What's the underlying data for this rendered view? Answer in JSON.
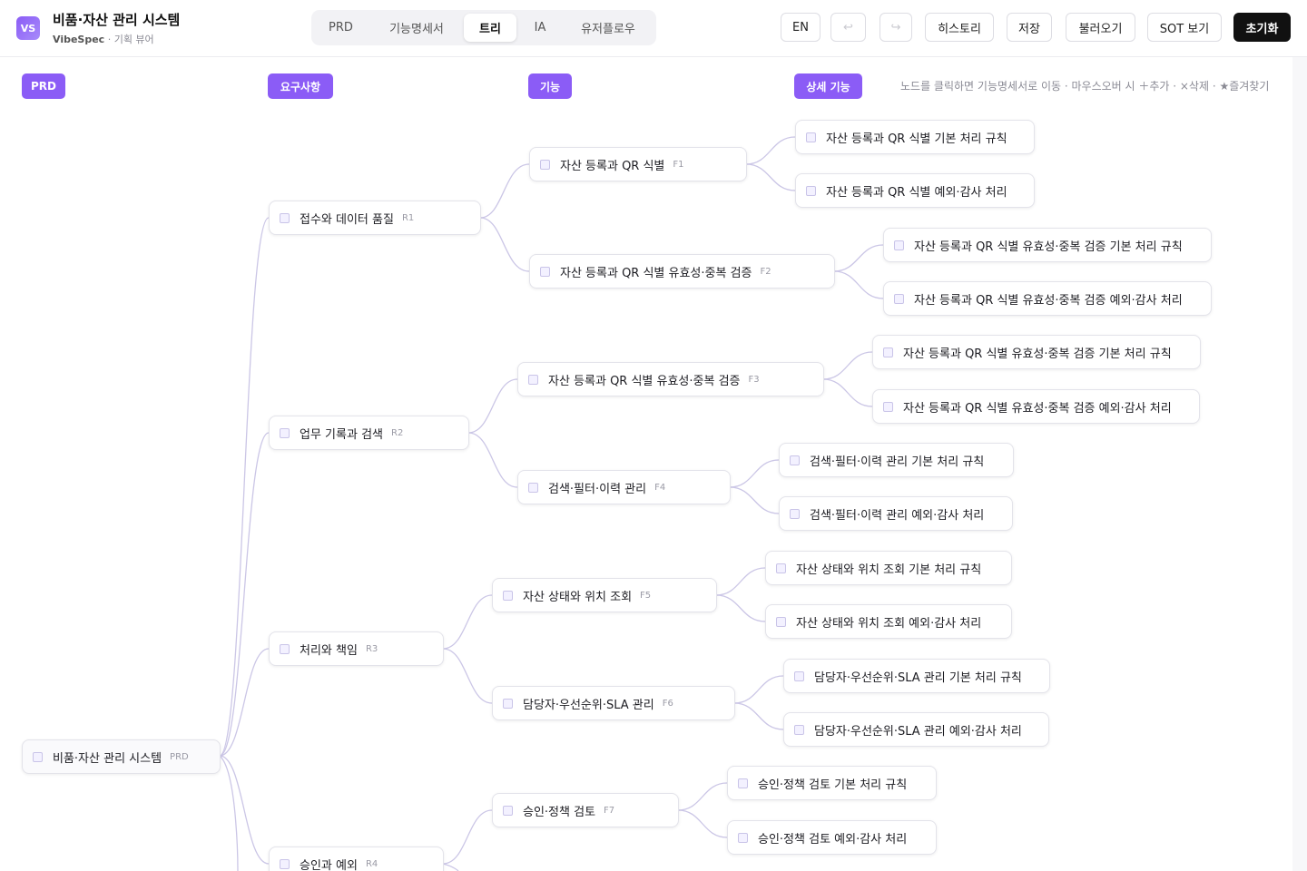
{
  "header": {
    "logo": "VS",
    "title": "비품·자산 관리 시스템",
    "brand": "VibeSpec",
    "subtitle": " · 기획 뷰어",
    "tabs": [
      {
        "label": "PRD",
        "active": false
      },
      {
        "label": "기능명세서",
        "active": false
      },
      {
        "label": "트리",
        "active": true
      },
      {
        "label": "IA",
        "active": false
      },
      {
        "label": "유저플로우",
        "active": false
      }
    ],
    "lang_label": "EN",
    "undo_icon": "undo-icon",
    "redo_icon": "redo-icon",
    "undo_glyph": "↩",
    "redo_glyph": "↪",
    "history_label": "히스토리",
    "save_label": "저장",
    "load_label": "불러오기",
    "sot_label": "SOT 보기",
    "reset_label": "초기화"
  },
  "columns": {
    "prd": "PRD",
    "requirements": "요구사항",
    "features": "기능",
    "details": "상세 기능"
  },
  "hint": "노드를 클릭하면 기능명세서로 이동 · 마우스오버 시 ＋추가 · ×삭제 · ★즐겨찾기",
  "tree": {
    "root": {
      "label": "비품·자산 관리 시스템",
      "code": "PRD"
    },
    "requirements": [
      {
        "label": "접수와 데이터 품질",
        "code": "R1"
      },
      {
        "label": "업무 기록과 검색",
        "code": "R2"
      },
      {
        "label": "처리와 책임",
        "code": "R3"
      },
      {
        "label": "승인과 예외",
        "code": "R4"
      }
    ],
    "features": [
      {
        "label": "자산 등록과 QR 식별",
        "code": "F1"
      },
      {
        "label": "자산 등록과 QR 식별 유효성·중복 검증",
        "code": "F2"
      },
      {
        "label": "자산 등록과 QR 식별 유효성·중복 검증",
        "code": "F3"
      },
      {
        "label": "검색·필터·이력 관리",
        "code": "F4"
      },
      {
        "label": "자산 상태와 위치 조회",
        "code": "F5"
      },
      {
        "label": "담당자·우선순위·SLA 관리",
        "code": "F6"
      },
      {
        "label": "승인·정책 검토",
        "code": "F7"
      }
    ],
    "details": [
      {
        "label": "자산 등록과 QR 식별 기본 처리 규칙"
      },
      {
        "label": "자산 등록과 QR 식별 예외·감사 처리"
      },
      {
        "label": "자산 등록과 QR 식별 유효성·중복 검증 기본 처리 규칙"
      },
      {
        "label": "자산 등록과 QR 식별 유효성·중복 검증 예외·감사 처리"
      },
      {
        "label": "자산 등록과 QR 식별 유효성·중복 검증 기본 처리 규칙"
      },
      {
        "label": "자산 등록과 QR 식별 유효성·중복 검증 예외·감사 처리"
      },
      {
        "label": "검색·필터·이력 관리 기본 처리 규칙"
      },
      {
        "label": "검색·필터·이력 관리 예외·감사 처리"
      },
      {
        "label": "자산 상태와 위치 조회 기본 처리 규칙"
      },
      {
        "label": "자산 상태와 위치 조회 예외·감사 처리"
      },
      {
        "label": "담당자·우선순위·SLA 관리 기본 처리 규칙"
      },
      {
        "label": "담당자·우선순위·SLA 관리 예외·감사 처리"
      },
      {
        "label": "승인·정책 검토 기본 처리 규칙"
      },
      {
        "label": "승인·정책 검토 예외·감사 처리"
      }
    ]
  }
}
